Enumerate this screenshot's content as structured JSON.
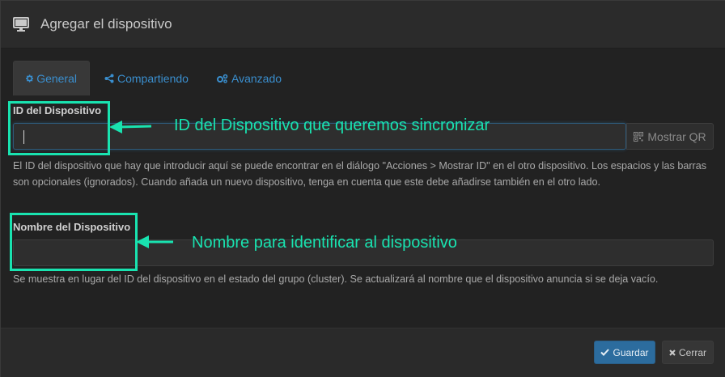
{
  "dialog": {
    "title": "Agregar el dispositivo",
    "title_icon": "monitor-icon"
  },
  "tabs": [
    {
      "label": "General",
      "icon": "gear-icon",
      "active": true
    },
    {
      "label": "Compartiendo",
      "icon": "share-icon",
      "active": false
    },
    {
      "label": "Avanzado",
      "icon": "gears-icon",
      "active": false
    }
  ],
  "device_id": {
    "label": "ID del Dispositivo",
    "value": "",
    "qr_button": "Mostrar QR",
    "help": "El ID del dispositivo que hay que introducir aquí se puede encontrar en el diálogo \"Acciones > Mostrar ID\" en el otro dispositivo. Los espacios y las barras son opcionales (ignorados). Cuando añada un nuevo dispositivo, tenga en cuenta que este debe añadirse también en el otro lado."
  },
  "device_name": {
    "label": "Nombre del Dispositivo",
    "value": "",
    "help": "Se muestra en lugar del ID del dispositivo en el estado del grupo (cluster). Se actualizará al nombre que el dispositivo anuncia si se deja vacío."
  },
  "annotations": {
    "id_note": "ID del Dispositivo que queremos sincronizar",
    "name_note": "Nombre para identificar al dispositivo",
    "color": "#19e3b0"
  },
  "footer": {
    "save_label": "Guardar",
    "close_label": "Cerrar"
  },
  "colors": {
    "accent": "#3a8fcf",
    "save_button": "#2c6c9e"
  }
}
